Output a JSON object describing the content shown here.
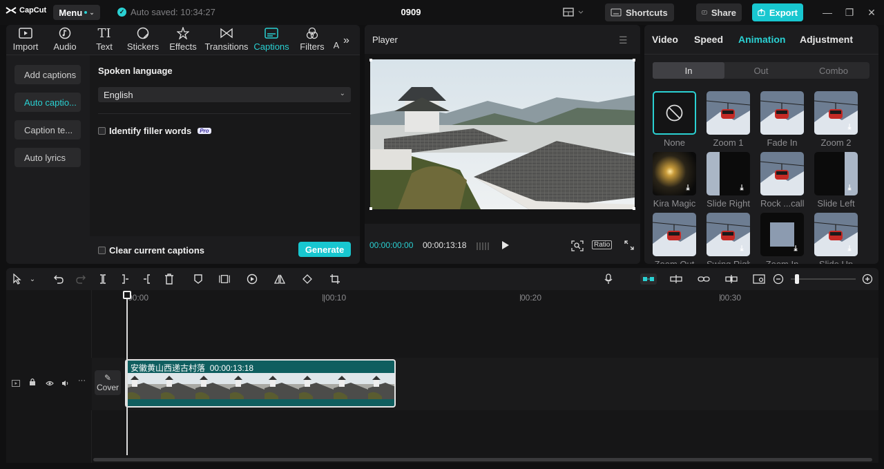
{
  "app": {
    "logo_text": "CapCut",
    "menu_label": "Menu",
    "autosave_text": "Auto saved: 10:34:27",
    "project_title": "0909"
  },
  "titlebar": {
    "shortcuts_label": "Shortcuts",
    "share_label": "Share",
    "export_label": "Export"
  },
  "toolbar": {
    "tabs": [
      {
        "label": "Import",
        "icon": "import-icon"
      },
      {
        "label": "Audio",
        "icon": "audio-icon"
      },
      {
        "label": "Text",
        "icon": "text-icon"
      },
      {
        "label": "Stickers",
        "icon": "stickers-icon"
      },
      {
        "label": "Effects",
        "icon": "effects-icon"
      },
      {
        "label": "Transitions",
        "icon": "transitions-icon"
      },
      {
        "label": "Captions",
        "icon": "captions-icon",
        "active": true
      },
      {
        "label": "Filters",
        "icon": "filters-icon"
      },
      {
        "label": "A",
        "icon": "adjustment-icon"
      }
    ]
  },
  "captions": {
    "subnav": [
      "Add captions",
      "Auto captio...",
      "Caption te...",
      "Auto lyrics"
    ],
    "spoken_language_label": "Spoken language",
    "language_value": "English",
    "filler_words_label": "Identify filler words",
    "pro_badge": "Pro",
    "clear_label": "Clear current captions",
    "generate_label": "Generate"
  },
  "player": {
    "title": "Player",
    "current_time": "00:00:00:00",
    "total_time": "00:00:13:18",
    "ratio_label": "Ratio"
  },
  "right": {
    "tabs": [
      "Video",
      "Speed",
      "Animation",
      "Adjustment"
    ],
    "active_tab": "Animation",
    "segments": [
      "In",
      "Out",
      "Combo"
    ],
    "animations": [
      "None",
      "Zoom 1",
      "Fade In",
      "Zoom 2",
      "Kira Magic",
      "Slide Right",
      "Rock ...cally",
      "Slide Left",
      "Zoom Out",
      "Swing Right",
      "Zoom In",
      "Slide Up"
    ]
  },
  "timeline": {
    "ruler": [
      "00:00",
      "00:10",
      "00:20",
      "00:30"
    ],
    "cover_label": "Cover",
    "clip_title": "安徽黄山西递古村落",
    "clip_duration": "00:00:13:18"
  },
  "colors": {
    "accent": "#2ad1d3",
    "export": "#18c7d0",
    "clip": "#0f5e5f"
  }
}
